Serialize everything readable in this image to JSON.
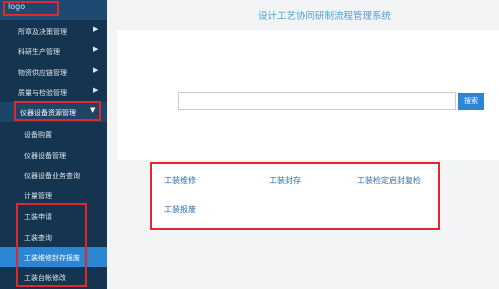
{
  "app": {
    "system_title": "设计工艺协同研制流程管理系统",
    "logo_text": "logo"
  },
  "sidebar": {
    "items": [
      {
        "label": "所章及决策管理",
        "has_arrow": true
      },
      {
        "label": "科研生产管理",
        "has_arrow": true
      },
      {
        "label": "物资供应链管理",
        "has_arrow": true
      },
      {
        "label": "质量与检验管理",
        "has_arrow": true
      },
      {
        "label": "仪器设备资源管理",
        "has_arrow": true,
        "expanded": true
      },
      {
        "label": "设备购置",
        "sub": true
      },
      {
        "label": "仪器设备管理",
        "sub": true
      },
      {
        "label": "仪器设备业务查询",
        "sub": true
      },
      {
        "label": "计量管理",
        "sub": true
      },
      {
        "label": "工装申请",
        "sub": true
      },
      {
        "label": "工装查询",
        "sub": true
      },
      {
        "label": "工装维修封存报废",
        "sub": true,
        "active": true
      },
      {
        "label": "工装台帐修改",
        "sub": true
      }
    ],
    "arrow_glyph": "▶",
    "expanded_glyph": "▼"
  },
  "search": {
    "value": "",
    "placeholder": "",
    "button_label": "搜索"
  },
  "actions": {
    "links": [
      {
        "label": "工装维修"
      },
      {
        "label": "工装封存"
      },
      {
        "label": "工装检定启封复检"
      },
      {
        "label": "工装报废"
      }
    ]
  },
  "colors": {
    "sidebar_bg": "#14344f",
    "accent": "#2d86d4",
    "highlight_border": "#e0282e",
    "link": "#2f6fb0",
    "title": "#4aa0d8"
  }
}
